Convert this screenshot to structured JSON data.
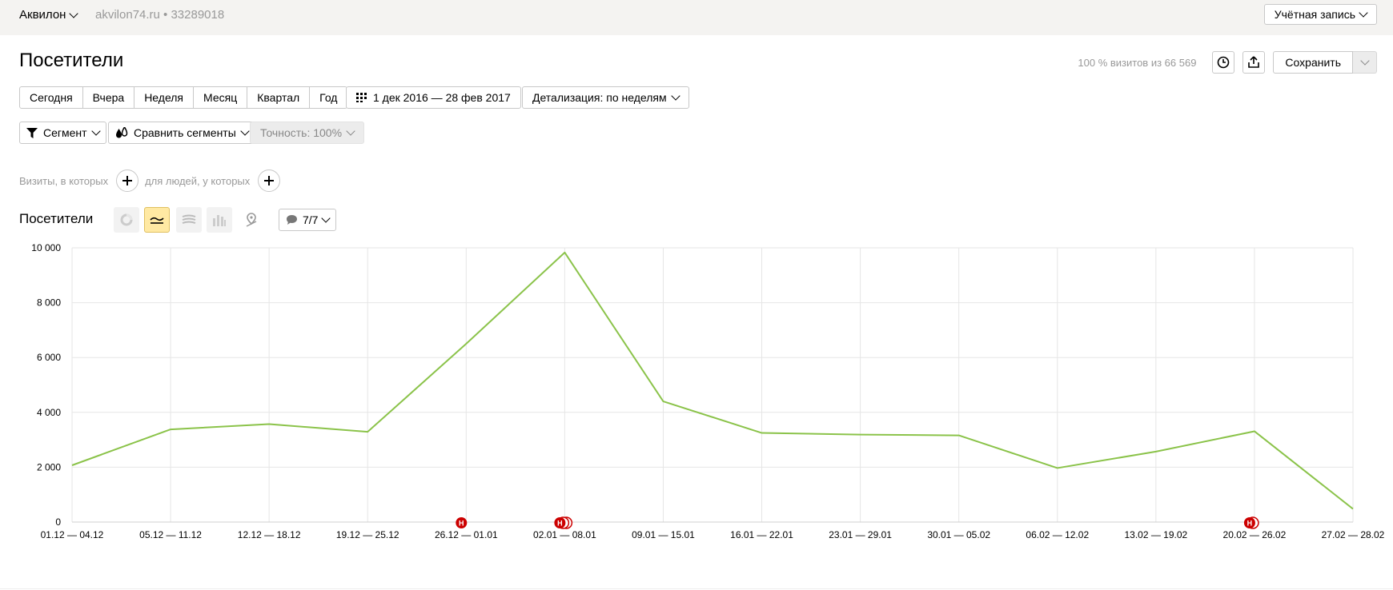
{
  "topbar": {
    "org": "Аквилон",
    "site": "akvilon74.ru • 33289018",
    "account": "Учётная запись"
  },
  "page": {
    "title": "Посетители",
    "visits_note": "100 % визитов из 66 569",
    "save_label": "Сохранить"
  },
  "periods": [
    "Сегодня",
    "Вчера",
    "Неделя",
    "Месяц",
    "Квартал",
    "Год"
  ],
  "date_range": "1 дек 2016 — 28 фев 2017",
  "detail": "Детализация: по неделям",
  "segment": "Сегмент",
  "compare": "Сравнить сегменты",
  "accuracy": "Точность: 100%",
  "filters": {
    "visits": "Визиты, в которых",
    "people": "для людей, у которых"
  },
  "chart_title": "Посетители",
  "notes": "7/7",
  "colors": {
    "line": "#8bc34a",
    "marker": "#cc0000",
    "grid": "#e6e6e6",
    "active": "#ffe9a3"
  },
  "chart_data": {
    "type": "line",
    "categories": [
      "01.12 — 04.12",
      "05.12 — 11.12",
      "12.12 — 18.12",
      "19.12 — 25.12",
      "26.12 — 01.01",
      "02.01 — 08.01",
      "09.01 — 15.01",
      "16.01 — 22.01",
      "23.01 — 29.01",
      "30.01 — 05.02",
      "06.02 — 12.02",
      "13.02 — 19.02",
      "20.02 — 26.02",
      "27.02 — 28.02"
    ],
    "series": [
      {
        "values": [
          2070,
          3380,
          3570,
          3290,
          6500,
          9830,
          4400,
          3250,
          3190,
          3160,
          1970,
          2570,
          3310,
          480
        ]
      }
    ],
    "y_ticks": [
      "0",
      "2 000",
      "4 000",
      "6 000",
      "8 000",
      "10 000"
    ],
    "ylim": [
      0,
      10000
    ],
    "grid": true,
    "annotations": [
      {
        "category": "26.12 — 01.01",
        "label": "Н",
        "count": 1
      },
      {
        "category": "02.01 — 08.01",
        "label": "Н",
        "count": 3
      },
      {
        "category": "20.02 — 26.02",
        "label": "Н",
        "count": 2
      }
    ]
  }
}
